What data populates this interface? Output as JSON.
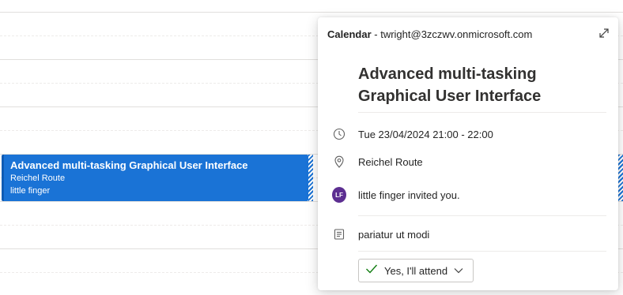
{
  "event_block": {
    "title": "Advanced multi-tasking Graphical User Interface",
    "location": "Reichel Route",
    "organizer": "little finger",
    "color": "#1a73d6"
  },
  "popup": {
    "calendar_label": "Calendar",
    "calendar_separator": " - ",
    "calendar_account": "twright@3zczwv.onmicrosoft.com",
    "title": "Advanced multi-tasking Graphical User Interface",
    "datetime": "Tue 23/04/2024 21:00 - 22:00",
    "location": "Reichel Route",
    "invite_initials": "LF",
    "invite_text": "little finger invited you.",
    "note": "pariatur ut modi",
    "rsvp_label": "Yes, I'll attend",
    "icons": {
      "expand": "expand-icon",
      "time": "clock-icon",
      "location": "location-pin-icon",
      "note": "notes-icon",
      "rsvp": "checkmark-icon",
      "dropdown": "chevron-down-icon"
    },
    "colors": {
      "avatar": "#5c2e91",
      "check": "#107c10"
    }
  }
}
